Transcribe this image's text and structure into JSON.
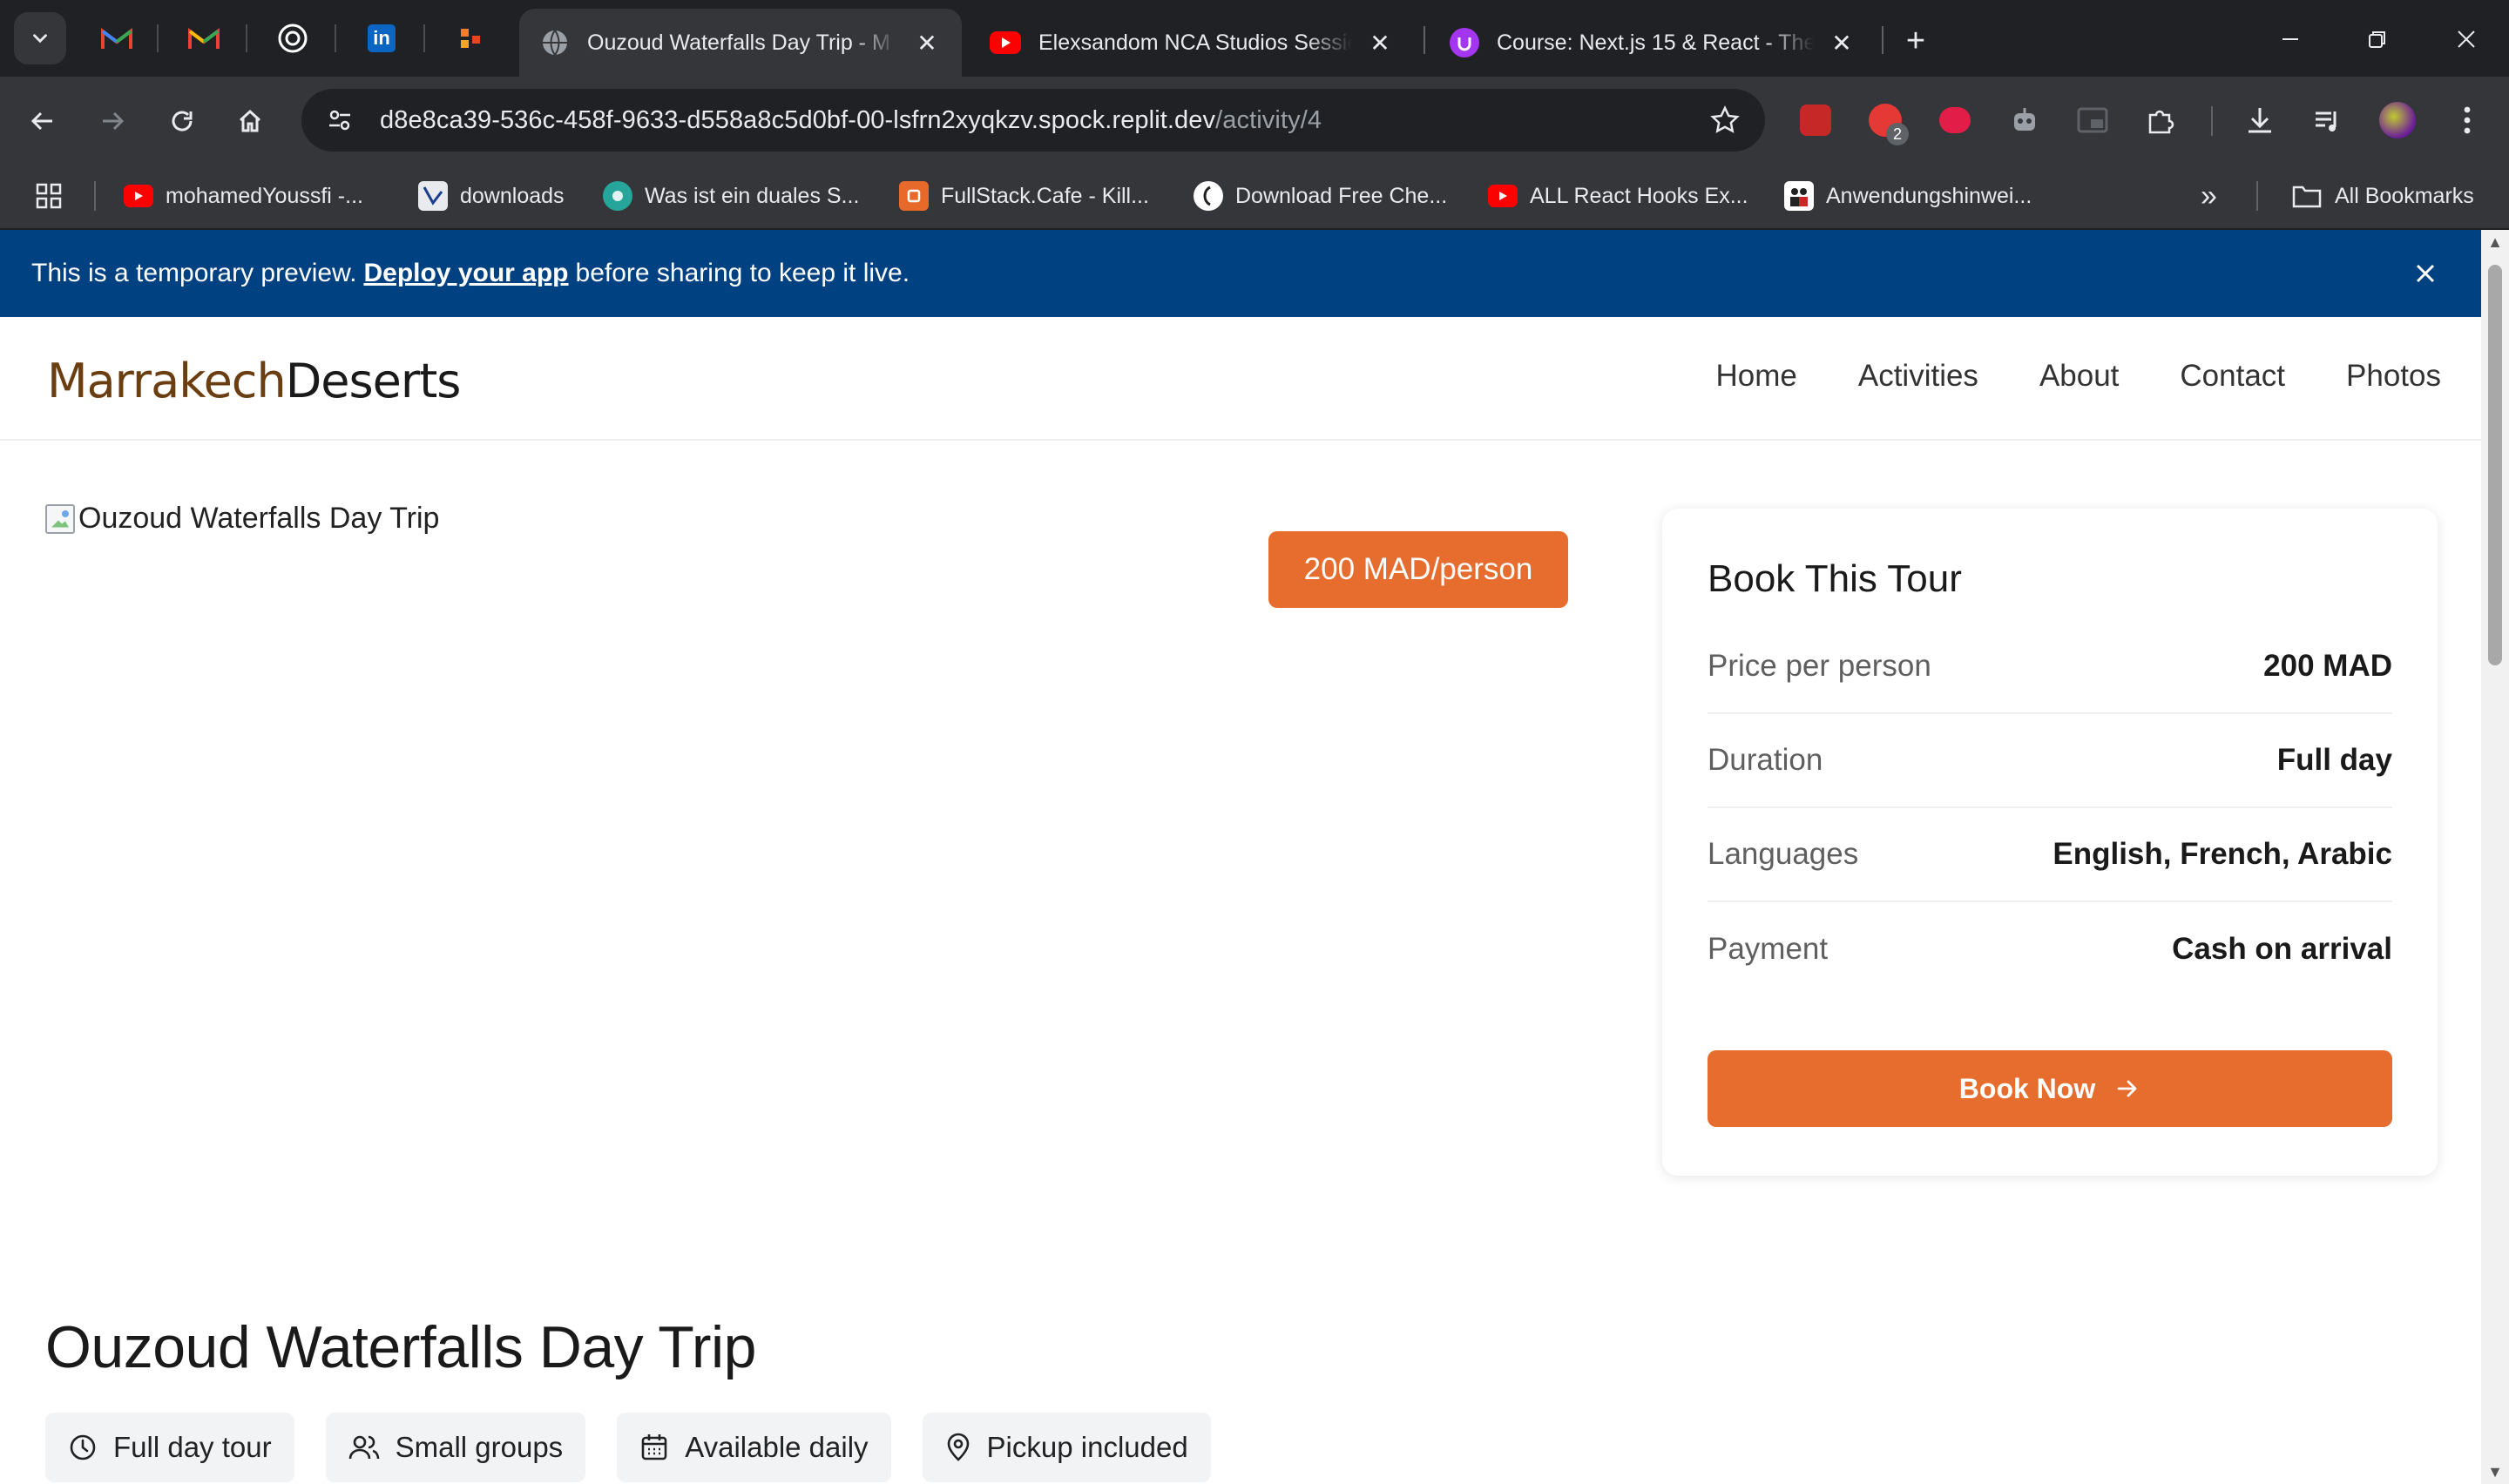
{
  "browser": {
    "tabs": [
      {
        "title": "Ouzoud Waterfalls Day Trip - M",
        "active": true
      },
      {
        "title": "Elexsandom NCA Studios Sessio",
        "active": false
      },
      {
        "title": "Course: Next.js 15 & React - The",
        "active": false
      }
    ],
    "pinned_tabs": [
      "gmail-icon",
      "gmail-icon",
      "chatgpt-icon",
      "linkedin-icon",
      "app-icon"
    ],
    "url_main": "d8e8ca39-536c-458f-9633-d558a8c5d0bf-00-lsfrn2xyqkzv.spock.replit.dev",
    "url_path": "/activity/4",
    "extension_badge": "2",
    "bookmarks": [
      {
        "label": "mohamedYoussfi -...",
        "icon": "youtube-icon"
      },
      {
        "label": "downloads",
        "icon": "downloads-icon"
      },
      {
        "label": "Was ist ein duales S...",
        "icon": "globe-icon"
      },
      {
        "label": "FullStack.Cafe - Kill...",
        "icon": "fullstack-icon"
      },
      {
        "label": "Download Free Che...",
        "icon": "bracket-icon"
      },
      {
        "label": "ALL React Hooks Ex...",
        "icon": "youtube-icon"
      },
      {
        "label": "Anwendungshinwei...",
        "icon": "people-icon"
      }
    ],
    "all_bookmarks": "All Bookmarks",
    "bookmarks_more": "»"
  },
  "banner": {
    "prefix": "This is a temporary preview.",
    "link": "Deploy your app",
    "suffix": "before sharing to keep it live."
  },
  "site": {
    "logo_part1": "Marrakech",
    "logo_part2": "Deserts",
    "nav": [
      "Home",
      "Activities",
      "About",
      "Contact",
      "Photos"
    ]
  },
  "hero": {
    "image_alt": "Ouzoud Waterfalls Day Trip",
    "price_badge": "200 MAD/person"
  },
  "booking": {
    "title": "Book This Tour",
    "rows": [
      {
        "label": "Price per person",
        "value": "200 MAD"
      },
      {
        "label": "Duration",
        "value": "Full day"
      },
      {
        "label": "Languages",
        "value": "English, French, Arabic"
      },
      {
        "label": "Payment",
        "value": "Cash on arrival"
      }
    ],
    "button": "Book Now"
  },
  "activity": {
    "title": "Ouzoud Waterfalls Day Trip",
    "tags": [
      {
        "label": "Full day tour",
        "icon": "clock-icon"
      },
      {
        "label": "Small groups",
        "icon": "users-icon"
      },
      {
        "label": "Available daily",
        "icon": "calendar-icon"
      },
      {
        "label": "Pickup included",
        "icon": "map-pin-icon"
      }
    ]
  },
  "colors": {
    "accent": "#e76d2f",
    "banner": "#004182",
    "logo_brown": "#6b3e12"
  }
}
